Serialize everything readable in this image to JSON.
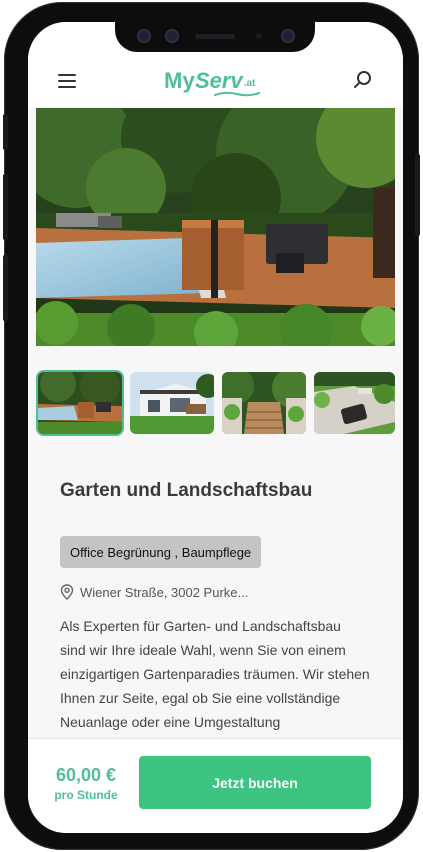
{
  "header": {
    "logo_main": "My",
    "logo_brand": "Serv",
    "logo_suffix": ".at",
    "menu_icon": "hamburger-menu-icon",
    "search_icon": "search-icon"
  },
  "gallery": {
    "hero_alt": "garden-terrace-with-pool-photo",
    "thumbnails": [
      {
        "name": "garden-terrace-thumbnail",
        "active": true
      },
      {
        "name": "modern-house-thumbnail",
        "active": false
      },
      {
        "name": "wooden-stairs-garden-thumbnail",
        "active": false
      },
      {
        "name": "garden-path-thumbnail",
        "active": false
      }
    ]
  },
  "service": {
    "title": "Garten und Landschaftsbau",
    "category": "Office Begrünung , Baumpflege",
    "location": "Wiener Straße, 3002 Purke...",
    "description": "Als Experten für Garten- und Landschaftsbau sind wir Ihre ideale Wahl, wenn Sie von einem einzigartigen Gartenparadies träumen. Wir stehen Ihnen zur Seite, egal ob Sie eine vollständige Neuanlage oder eine Umgestaltung"
  },
  "booking": {
    "price": "60,00 €",
    "unit": "pro Stunde",
    "button_label": "Jetzt buchen"
  },
  "colors": {
    "accent": "#4fbf95",
    "button": "#3cc480",
    "badge": "#c4c4c4"
  }
}
